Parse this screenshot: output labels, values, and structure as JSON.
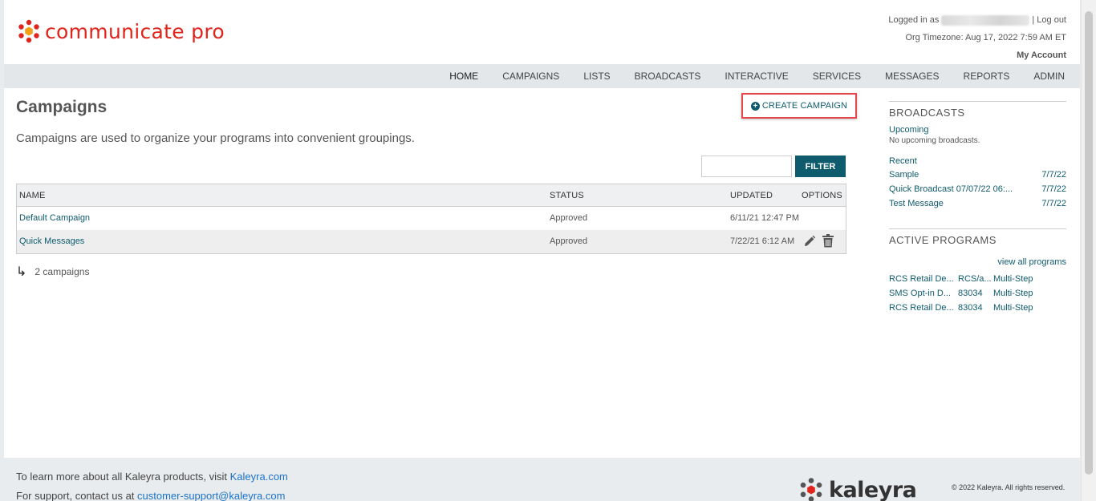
{
  "header": {
    "logo_text": "communicate pro",
    "logged_in_prefix": "Logged in as",
    "logout": "| Log out",
    "timezone": "Org Timezone: Aug 17, 2022 7:59 AM ET",
    "my_account": "My Account"
  },
  "nav": {
    "items": [
      "HOME",
      "CAMPAIGNS",
      "LISTS",
      "BROADCASTS",
      "INTERACTIVE",
      "SERVICES",
      "MESSAGES",
      "REPORTS",
      "ADMIN"
    ]
  },
  "main": {
    "title": "Campaigns",
    "create_button": "CREATE CAMPAIGN",
    "description": "Campaigns are used to organize your programs into convenient groupings.",
    "filter_input_value": "",
    "filter_button": "FILTER",
    "table": {
      "headers": [
        "NAME",
        "STATUS",
        "UPDATED",
        "OPTIONS"
      ],
      "rows": [
        {
          "name": "Default Campaign",
          "status": "Approved",
          "updated": "6/11/21 12:47 PM"
        },
        {
          "name": "Quick Messages",
          "status": "Approved",
          "updated": "7/22/21 6:12 AM"
        }
      ]
    },
    "count_text": "2 campaigns"
  },
  "sidebar": {
    "broadcasts_title": "BROADCASTS",
    "upcoming_label": "Upcoming",
    "no_upcoming": "No upcoming broadcasts.",
    "recent_label": "Recent",
    "recent": [
      {
        "name": "Sample",
        "date": "7/7/22"
      },
      {
        "name": "Quick Broadcast 07/07/22 06:...",
        "date": "7/7/22"
      },
      {
        "name": "Test Message",
        "date": "7/7/22"
      }
    ],
    "active_title": "ACTIVE PROGRAMS",
    "view_all": "view all programs",
    "programs": [
      {
        "name": "RCS Retail De...",
        "code": "RCS/a...",
        "type": "Multi-Step"
      },
      {
        "name": "SMS Opt-in D...",
        "code": "83034",
        "type": "Multi-Step"
      },
      {
        "name": "RCS Retail De...",
        "code": "83034",
        "type": "Multi-Step"
      }
    ]
  },
  "footer": {
    "learn_prefix": "To learn more about all Kaleyra products, visit ",
    "learn_link": "Kaleyra.com",
    "support_prefix": "For support, contact us at ",
    "support_link": "customer-support@kaleyra.com",
    "brand": "kaleyra",
    "copyright": "© 2022 Kaleyra. All rights reserved."
  },
  "colors": {
    "brand_red": "#e0241b",
    "accent_teal": "#0e5b6e",
    "highlight_box": "#e4474c"
  }
}
